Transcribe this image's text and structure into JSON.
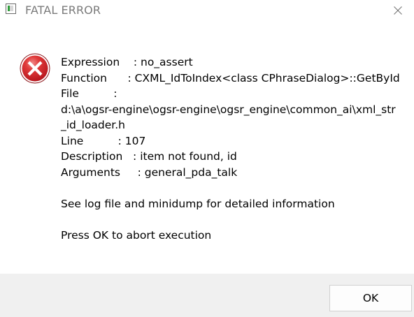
{
  "window": {
    "title": "FATAL ERROR",
    "icons": {
      "app": "app-icon",
      "close": "close-icon",
      "error": "error-x-icon"
    },
    "colors": {
      "error_red": "#c8151b",
      "footer_bg": "#f0f0f0",
      "title_text": "#7a7a7a"
    }
  },
  "message": {
    "expression": "Expression    : no_assert",
    "function": "Function      : CXML_IdToIndex<class CPhraseDialog>::GetById",
    "file_label": "File          :",
    "file_path": "d:\\a\\ogsr-engine\\ogsr-engine\\ogsr_engine\\common_ai\\xml_str_id_loader.h",
    "line": "Line          : 107",
    "description": "Description   : item not found, id",
    "arguments": "Arguments     : general_pda_talk",
    "log_hint": "See log file and minidump for detailed information",
    "abort_hint": "Press OK to abort execution"
  },
  "buttons": {
    "ok_label": "OK"
  }
}
